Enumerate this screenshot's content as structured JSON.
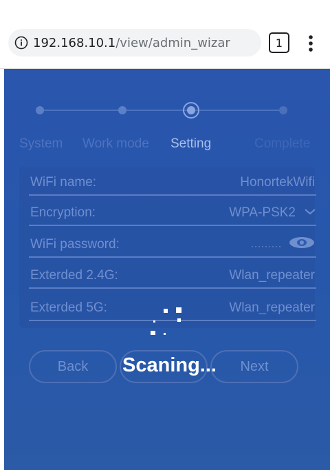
{
  "browser": {
    "url_host": "192.168.10.1",
    "url_path": "/view/admin_wizar",
    "tab_count": "1"
  },
  "wizard": {
    "steps": [
      {
        "label": "System",
        "state": "done"
      },
      {
        "label": "Work mode",
        "state": "done"
      },
      {
        "label": "Setting",
        "state": "active"
      },
      {
        "label": "Complete",
        "state": "pending"
      }
    ],
    "fields": {
      "wifi_name_label": "WiFi name:",
      "wifi_name_value": "HonortekWifi",
      "encryption_label": "Encryption:",
      "encryption_value": "WPA-PSK2",
      "password_label": "WiFi password:",
      "password_value": "·········",
      "ext24_label": "Exterded 2.4G:",
      "ext24_value": "Wlan_repeater",
      "ext5_label": "Exterded 5G:",
      "ext5_value": "Wlan_repeater"
    },
    "buttons": {
      "back": "Back",
      "next": "Next"
    },
    "loading_text": "Scaning...",
    "colors": {
      "background": "#2a56ad",
      "active_step": "#a9c0ec",
      "muted_text": "#6f8fcf"
    }
  }
}
